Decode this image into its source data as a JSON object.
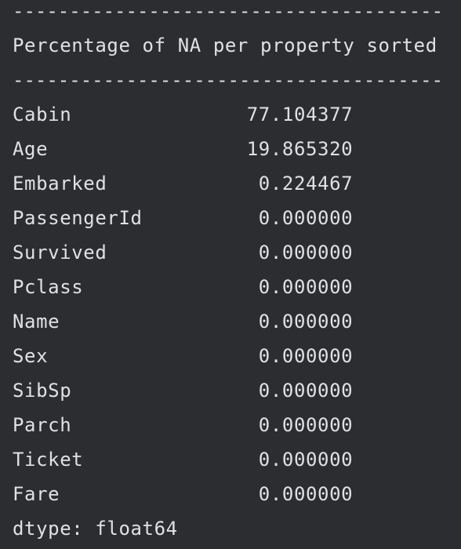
{
  "console": {
    "divider_top": "--------------------------------------",
    "header": "Percentage of NA per property sorted",
    "divider_bottom": "--------------------------------------",
    "rows": [
      {
        "name": "Cabin",
        "value": "77.104377"
      },
      {
        "name": "Age",
        "value": "19.865320"
      },
      {
        "name": "Embarked",
        "value": "0.224467"
      },
      {
        "name": "PassengerId",
        "value": "0.000000"
      },
      {
        "name": "Survived",
        "value": "0.000000"
      },
      {
        "name": "Pclass",
        "value": "0.000000"
      },
      {
        "name": "Name",
        "value": "0.000000"
      },
      {
        "name": "Sex",
        "value": "0.000000"
      },
      {
        "name": "SibSp",
        "value": "0.000000"
      },
      {
        "name": "Parch",
        "value": "0.000000"
      },
      {
        "name": "Ticket",
        "value": "0.000000"
      },
      {
        "name": "Fare",
        "value": "0.000000"
      }
    ],
    "dtype": "dtype: float64"
  }
}
